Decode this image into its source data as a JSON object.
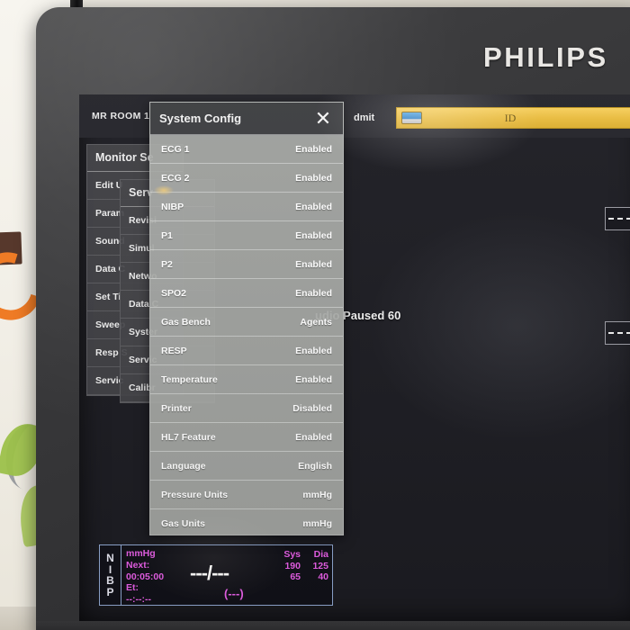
{
  "device": {
    "brand": "PHILIPS"
  },
  "screen": {
    "top_bar": {
      "room_label": "MR ROOM 1",
      "admit_label": "dmit",
      "id_bar_text": "ID",
      "id_chip_icon": "patient-card-icon"
    },
    "alarm_text": "udio Paused 60",
    "waveform_boxes": [
      {
        "name": "waveform-box-1"
      },
      {
        "name": "waveform-box-2"
      }
    ]
  },
  "monitor_setup_menu": {
    "title": "Monitor Se",
    "items": [
      {
        "label": "Edit U"
      },
      {
        "label": "Param"
      },
      {
        "label": "Sound"
      },
      {
        "label": "Data C"
      },
      {
        "label": "Set Ti"
      },
      {
        "label": "Sweep"
      },
      {
        "label": "Resp S"
      },
      {
        "label": "Servic"
      }
    ]
  },
  "service_menu": {
    "title": "Serv",
    "items": [
      {
        "label": "Revisi"
      },
      {
        "label": "Simul"
      },
      {
        "label": "Netwo"
      },
      {
        "label": "Data C"
      },
      {
        "label": "Syster"
      },
      {
        "label": "Servic"
      },
      {
        "label": "Calibr"
      }
    ]
  },
  "system_config_dialog": {
    "title": "System Config",
    "close_icon": "close-icon",
    "rows": [
      {
        "label": "ECG 1",
        "value": "Enabled"
      },
      {
        "label": "ECG 2",
        "value": "Enabled"
      },
      {
        "label": "NIBP",
        "value": "Enabled"
      },
      {
        "label": "P1",
        "value": "Enabled"
      },
      {
        "label": "P2",
        "value": "Enabled"
      },
      {
        "label": "SPO2",
        "value": "Enabled"
      },
      {
        "label": "Gas Bench",
        "value": "Agents"
      },
      {
        "label": "RESP",
        "value": "Enabled"
      },
      {
        "label": "Temperature",
        "value": "Enabled"
      },
      {
        "label": "Printer",
        "value": "Disabled"
      },
      {
        "label": "HL7 Feature",
        "value": "Enabled"
      },
      {
        "label": "Language",
        "value": "English"
      },
      {
        "label": "Pressure Units",
        "value": "mmHg"
      },
      {
        "label": "Gas Units",
        "value": "mmHg"
      }
    ]
  },
  "nibp_panel": {
    "tag": "NIBP",
    "unit": "mmHg",
    "next_label": "Next:",
    "next_time": "00:05:00",
    "et_label": "Et:",
    "et_time": "--:--:--",
    "reading": "---/---",
    "mean": "(---)",
    "sys_header": "Sys",
    "dia_header": "Dia",
    "sys_high": "190",
    "dia_high": "125",
    "sys_low": "65",
    "dia_low": "40",
    "accent_color": "#e85fe8",
    "border_color": "#8fa6cf"
  }
}
